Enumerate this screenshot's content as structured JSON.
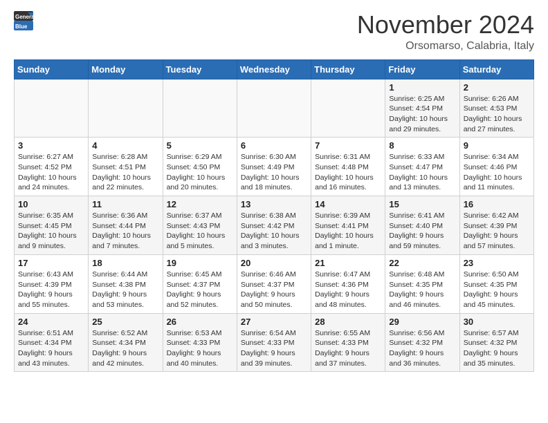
{
  "logo": {
    "general": "General",
    "blue": "Blue"
  },
  "header": {
    "month": "November 2024",
    "location": "Orsomarso, Calabria, Italy"
  },
  "weekdays": [
    "Sunday",
    "Monday",
    "Tuesday",
    "Wednesday",
    "Thursday",
    "Friday",
    "Saturday"
  ],
  "weeks": [
    [
      {
        "day": "",
        "info": ""
      },
      {
        "day": "",
        "info": ""
      },
      {
        "day": "",
        "info": ""
      },
      {
        "day": "",
        "info": ""
      },
      {
        "day": "",
        "info": ""
      },
      {
        "day": "1",
        "info": "Sunrise: 6:25 AM\nSunset: 4:54 PM\nDaylight: 10 hours and 29 minutes."
      },
      {
        "day": "2",
        "info": "Sunrise: 6:26 AM\nSunset: 4:53 PM\nDaylight: 10 hours and 27 minutes."
      }
    ],
    [
      {
        "day": "3",
        "info": "Sunrise: 6:27 AM\nSunset: 4:52 PM\nDaylight: 10 hours and 24 minutes."
      },
      {
        "day": "4",
        "info": "Sunrise: 6:28 AM\nSunset: 4:51 PM\nDaylight: 10 hours and 22 minutes."
      },
      {
        "day": "5",
        "info": "Sunrise: 6:29 AM\nSunset: 4:50 PM\nDaylight: 10 hours and 20 minutes."
      },
      {
        "day": "6",
        "info": "Sunrise: 6:30 AM\nSunset: 4:49 PM\nDaylight: 10 hours and 18 minutes."
      },
      {
        "day": "7",
        "info": "Sunrise: 6:31 AM\nSunset: 4:48 PM\nDaylight: 10 hours and 16 minutes."
      },
      {
        "day": "8",
        "info": "Sunrise: 6:33 AM\nSunset: 4:47 PM\nDaylight: 10 hours and 13 minutes."
      },
      {
        "day": "9",
        "info": "Sunrise: 6:34 AM\nSunset: 4:46 PM\nDaylight: 10 hours and 11 minutes."
      }
    ],
    [
      {
        "day": "10",
        "info": "Sunrise: 6:35 AM\nSunset: 4:45 PM\nDaylight: 10 hours and 9 minutes."
      },
      {
        "day": "11",
        "info": "Sunrise: 6:36 AM\nSunset: 4:44 PM\nDaylight: 10 hours and 7 minutes."
      },
      {
        "day": "12",
        "info": "Sunrise: 6:37 AM\nSunset: 4:43 PM\nDaylight: 10 hours and 5 minutes."
      },
      {
        "day": "13",
        "info": "Sunrise: 6:38 AM\nSunset: 4:42 PM\nDaylight: 10 hours and 3 minutes."
      },
      {
        "day": "14",
        "info": "Sunrise: 6:39 AM\nSunset: 4:41 PM\nDaylight: 10 hours and 1 minute."
      },
      {
        "day": "15",
        "info": "Sunrise: 6:41 AM\nSunset: 4:40 PM\nDaylight: 9 hours and 59 minutes."
      },
      {
        "day": "16",
        "info": "Sunrise: 6:42 AM\nSunset: 4:39 PM\nDaylight: 9 hours and 57 minutes."
      }
    ],
    [
      {
        "day": "17",
        "info": "Sunrise: 6:43 AM\nSunset: 4:39 PM\nDaylight: 9 hours and 55 minutes."
      },
      {
        "day": "18",
        "info": "Sunrise: 6:44 AM\nSunset: 4:38 PM\nDaylight: 9 hours and 53 minutes."
      },
      {
        "day": "19",
        "info": "Sunrise: 6:45 AM\nSunset: 4:37 PM\nDaylight: 9 hours and 52 minutes."
      },
      {
        "day": "20",
        "info": "Sunrise: 6:46 AM\nSunset: 4:37 PM\nDaylight: 9 hours and 50 minutes."
      },
      {
        "day": "21",
        "info": "Sunrise: 6:47 AM\nSunset: 4:36 PM\nDaylight: 9 hours and 48 minutes."
      },
      {
        "day": "22",
        "info": "Sunrise: 6:48 AM\nSunset: 4:35 PM\nDaylight: 9 hours and 46 minutes."
      },
      {
        "day": "23",
        "info": "Sunrise: 6:50 AM\nSunset: 4:35 PM\nDaylight: 9 hours and 45 minutes."
      }
    ],
    [
      {
        "day": "24",
        "info": "Sunrise: 6:51 AM\nSunset: 4:34 PM\nDaylight: 9 hours and 43 minutes."
      },
      {
        "day": "25",
        "info": "Sunrise: 6:52 AM\nSunset: 4:34 PM\nDaylight: 9 hours and 42 minutes."
      },
      {
        "day": "26",
        "info": "Sunrise: 6:53 AM\nSunset: 4:33 PM\nDaylight: 9 hours and 40 minutes."
      },
      {
        "day": "27",
        "info": "Sunrise: 6:54 AM\nSunset: 4:33 PM\nDaylight: 9 hours and 39 minutes."
      },
      {
        "day": "28",
        "info": "Sunrise: 6:55 AM\nSunset: 4:33 PM\nDaylight: 9 hours and 37 minutes."
      },
      {
        "day": "29",
        "info": "Sunrise: 6:56 AM\nSunset: 4:32 PM\nDaylight: 9 hours and 36 minutes."
      },
      {
        "day": "30",
        "info": "Sunrise: 6:57 AM\nSunset: 4:32 PM\nDaylight: 9 hours and 35 minutes."
      }
    ]
  ]
}
